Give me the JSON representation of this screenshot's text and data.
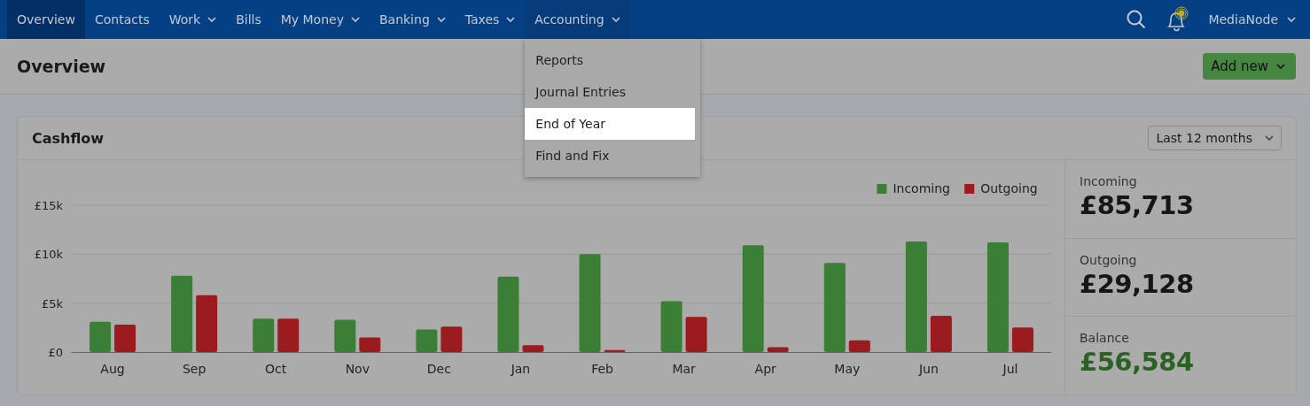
{
  "nav": {
    "items": [
      {
        "label": "Overview",
        "selected": true,
        "dropdown": false
      },
      {
        "label": "Contacts",
        "selected": false,
        "dropdown": false
      },
      {
        "label": "Work",
        "selected": false,
        "dropdown": true
      },
      {
        "label": "Bills",
        "selected": false,
        "dropdown": false
      },
      {
        "label": "My Money",
        "selected": false,
        "dropdown": true
      },
      {
        "label": "Banking",
        "selected": false,
        "dropdown": true
      },
      {
        "label": "Taxes",
        "selected": false,
        "dropdown": true
      },
      {
        "label": "Accounting",
        "selected": false,
        "dropdown": true,
        "expanded": true
      }
    ],
    "account": "MediaNode"
  },
  "menu": {
    "items": [
      {
        "label": "Reports",
        "selected": false
      },
      {
        "label": "Journal Entries",
        "selected": false
      },
      {
        "label": "End of Year",
        "selected": true
      },
      {
        "label": "Find and Fix",
        "selected": false
      }
    ]
  },
  "page": {
    "title": "Overview",
    "add_button": "Add new"
  },
  "cashflow": {
    "title": "Cashflow",
    "period": "Last 12 months",
    "chart_data": {
      "type": "bar",
      "categories": [
        "Aug",
        "Sep",
        "Oct",
        "Nov",
        "Dec",
        "Jan",
        "Feb",
        "Mar",
        "Apr",
        "May",
        "Jun",
        "Jul"
      ],
      "series": [
        {
          "name": "Incoming",
          "color": "#3a7f35",
          "values": [
            3100,
            7800,
            3400,
            3300,
            2300,
            7700,
            10000,
            5200,
            10900,
            9100,
            11300,
            11200
          ]
        },
        {
          "name": "Outgoing",
          "color": "#9b1b1e",
          "values": [
            2800,
            5800,
            3400,
            1500,
            2600,
            700,
            200,
            3600,
            500,
            1200,
            3700,
            2500
          ]
        }
      ],
      "legend": "top-right",
      "ylim": [
        0,
        15000
      ],
      "yticks": [
        {
          "value": 0,
          "label": "£0"
        },
        {
          "value": 5000,
          "label": "£5k"
        },
        {
          "value": 10000,
          "label": "£10k"
        },
        {
          "value": 15000,
          "label": "£15k"
        }
      ]
    },
    "stats": [
      {
        "label": "Incoming",
        "value": "£85,713",
        "kind": "plain"
      },
      {
        "label": "Outgoing",
        "value": "£29,128",
        "kind": "plain"
      },
      {
        "label": "Balance",
        "value": "£56,584",
        "kind": "positive"
      }
    ]
  }
}
